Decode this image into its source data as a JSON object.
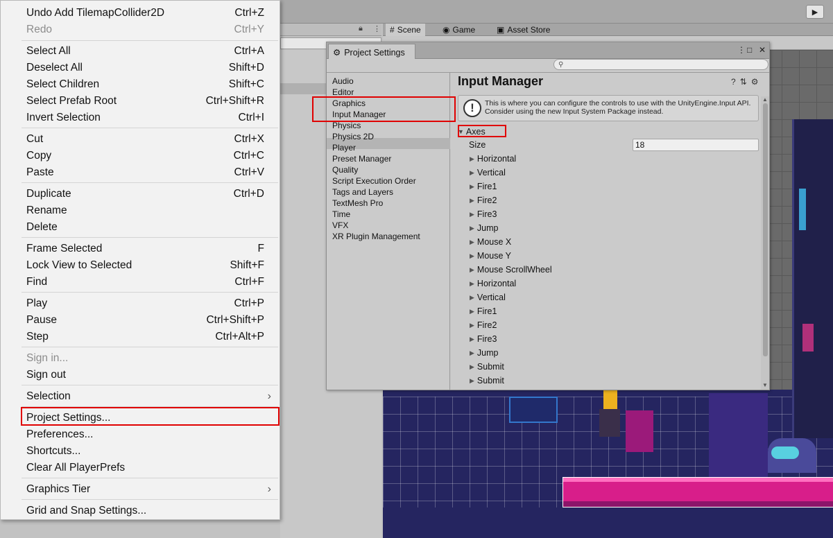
{
  "context_menu": {
    "items": [
      {
        "label": "Undo Add TilemapCollider2D",
        "shortcut": "Ctrl+Z",
        "disabled": false
      },
      {
        "label": "Redo",
        "shortcut": "Ctrl+Y",
        "disabled": true
      },
      {
        "label": "Select All",
        "shortcut": "Ctrl+A",
        "disabled": false
      },
      {
        "label": "Deselect All",
        "shortcut": "Shift+D",
        "disabled": false
      },
      {
        "label": "Select Children",
        "shortcut": "Shift+C",
        "disabled": false
      },
      {
        "label": "Select Prefab Root",
        "shortcut": "Ctrl+Shift+R",
        "disabled": false
      },
      {
        "label": "Invert Selection",
        "shortcut": "Ctrl+I",
        "disabled": false
      },
      {
        "label": "Cut",
        "shortcut": "Ctrl+X",
        "disabled": false
      },
      {
        "label": "Copy",
        "shortcut": "Ctrl+C",
        "disabled": false
      },
      {
        "label": "Paste",
        "shortcut": "Ctrl+V",
        "disabled": false
      },
      {
        "label": "Duplicate",
        "shortcut": "Ctrl+D",
        "disabled": false
      },
      {
        "label": "Rename",
        "shortcut": "",
        "disabled": false
      },
      {
        "label": "Delete",
        "shortcut": "",
        "disabled": false
      },
      {
        "label": "Frame Selected",
        "shortcut": "F",
        "disabled": false
      },
      {
        "label": "Lock View to Selected",
        "shortcut": "Shift+F",
        "disabled": false
      },
      {
        "label": "Find",
        "shortcut": "Ctrl+F",
        "disabled": false
      },
      {
        "label": "Play",
        "shortcut": "Ctrl+P",
        "disabled": false
      },
      {
        "label": "Pause",
        "shortcut": "Ctrl+Shift+P",
        "disabled": false
      },
      {
        "label": "Step",
        "shortcut": "Ctrl+Alt+P",
        "disabled": false
      },
      {
        "label": "Sign in...",
        "shortcut": "",
        "disabled": true
      },
      {
        "label": "Sign out",
        "shortcut": "",
        "disabled": false
      },
      {
        "label": "Selection",
        "shortcut": "",
        "disabled": false,
        "submenu": true
      },
      {
        "label": "Project Settings...",
        "shortcut": "",
        "disabled": false,
        "highlighted": true
      },
      {
        "label": "Preferences...",
        "shortcut": "",
        "disabled": false
      },
      {
        "label": "Shortcuts...",
        "shortcut": "",
        "disabled": false
      },
      {
        "label": "Clear All PlayerPrefs",
        "shortcut": "",
        "disabled": false
      },
      {
        "label": "Graphics Tier",
        "shortcut": "",
        "disabled": false,
        "submenu": true
      },
      {
        "label": "Grid and Snap Settings...",
        "shortcut": "",
        "disabled": false
      }
    ]
  },
  "editor": {
    "tabs": [
      {
        "label": "Scene",
        "icon": "hash-icon"
      },
      {
        "label": "Game",
        "icon": "gamepad-icon"
      },
      {
        "label": "Asset Store",
        "icon": "shopping-bag-icon"
      }
    ],
    "play_icon": "play-icon"
  },
  "project_settings": {
    "window_title": "Project Settings",
    "sidebar": [
      "Audio",
      "Editor",
      "Graphics",
      "Input Manager",
      "Physics",
      "Physics 2D",
      "Player",
      "Preset Manager",
      "Quality",
      "Script Execution Order",
      "Tags and Layers",
      "TextMesh Pro",
      "Time",
      "VFX",
      "XR Plugin Management"
    ],
    "selected": "Input Manager",
    "page_title": "Input Manager",
    "info_message": "This is where you can configure the controls to use with the UnityEngine.Input API. Consider using the new Input System Package instead.",
    "axes_label": "Axes",
    "size_label": "Size",
    "size_value": "18",
    "axes": [
      "Horizontal",
      "Vertical",
      "Fire1",
      "Fire2",
      "Fire3",
      "Jump",
      "Mouse X",
      "Mouse Y",
      "Mouse ScrollWheel",
      "Horizontal",
      "Vertical",
      "Fire1",
      "Fire2",
      "Fire3",
      "Jump",
      "Submit",
      "Submit"
    ]
  }
}
